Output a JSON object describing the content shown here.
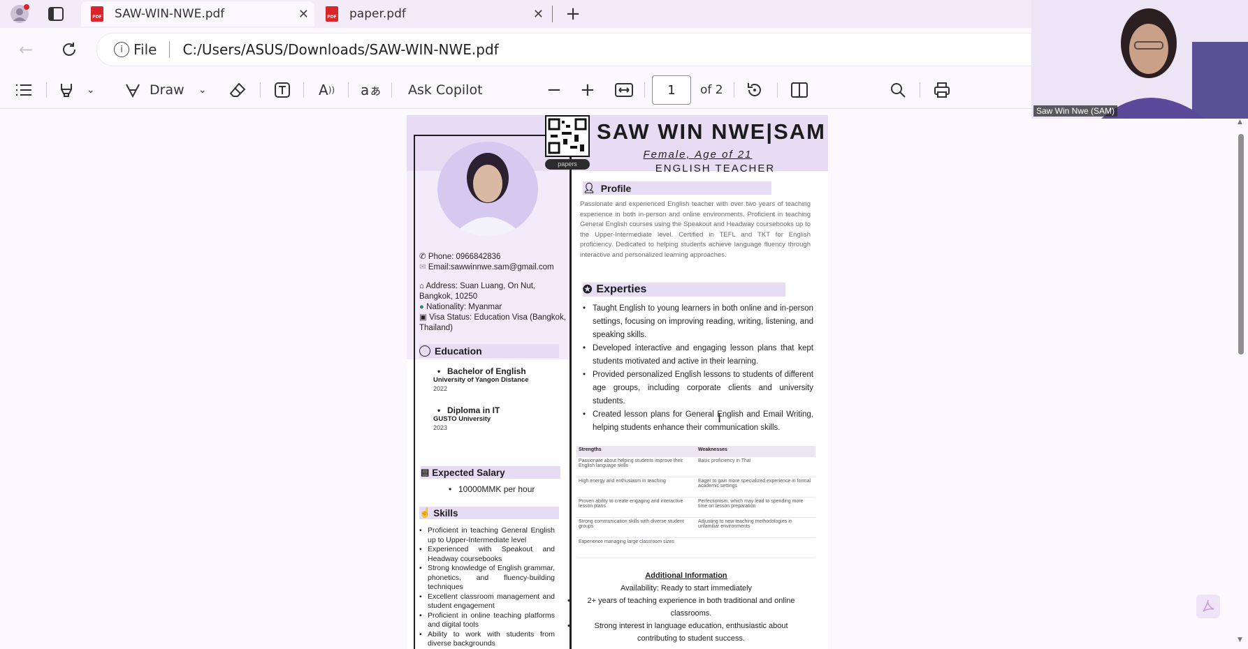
{
  "browser": {
    "tabs": [
      {
        "title": "SAW-WIN-NWE.pdf",
        "active": true
      },
      {
        "title": "paper.pdf",
        "active": false
      }
    ],
    "file_label": "File",
    "url": "C:/Users/ASUS/Downloads/SAW-WIN-NWE.pdf"
  },
  "toolbar": {
    "draw_label": "Draw",
    "copilot_label": "Ask Copilot",
    "page_current": "1",
    "page_total": "of 2"
  },
  "video": {
    "participant": "Saw Win Nwe (SAM)"
  },
  "resume": {
    "qr_caption": "papers",
    "name": "SAW WIN NWE|SAM",
    "subtitle": "Female, Age of 21",
    "role": "ENGLISH TEACHER",
    "contact": {
      "phone": "Phone: 0966842836",
      "email": "Email:sawwinnwe.sam@gmail.com",
      "address": "Address: Suan Luang, On Nut, Bangkok, 10250",
      "nationality": "Nationality: Myanmar",
      "visa": "Visa Status: Education Visa (Bangkok, Thailand)"
    },
    "education": {
      "heading": "Education",
      "items": [
        {
          "degree": "Bachelor of English",
          "school": "University of Yangon Distance",
          "year": "2022"
        },
        {
          "degree": "Diploma in IT",
          "school": "GUSTO University",
          "year": "2023"
        }
      ]
    },
    "salary": {
      "heading": "Expected Salary",
      "value": "10000MMK per hour"
    },
    "skills": {
      "heading": "Skills",
      "items": [
        "Proficient in teaching General English up to Upper-Intermediate level",
        "Experienced with Speakout and Headway coursebooks",
        "Strong knowledge of English grammar, phonetics, and fluency-building techniques",
        "Excellent classroom management and student engagement",
        "Proficient in online teaching platforms and digital tools",
        "Ability to work with students from diverse backgrounds"
      ]
    },
    "profile": {
      "heading": "Profile",
      "text": "Passionate and experienced English teacher with over two years of teaching experience in both in-person and online environments. Proficient in teaching General English courses using the Speakout and Headway coursebooks up to the Upper-Intermediate level. Certified in TEFL and TKT for English proficiency. Dedicated to helping students achieve language fluency through interactive and personalized learning approaches."
    },
    "experties": {
      "heading": "Experties",
      "items": [
        "Taught English to young learners in both online and in-person settings, focusing on improving reading, writing, listening, and speaking skills.",
        "Developed interactive and engaging lesson plans that kept students motivated and active in their learning.",
        "Provided personalized English lessons to students of different age groups, including corporate clients and university students.",
        "Created lesson plans for General English and Email Writing, helping students enhance their communication skills."
      ]
    },
    "sw_table": {
      "headers": [
        "Strengths",
        "Weaknesses"
      ],
      "rows": [
        [
          "Passionate about helping students improve their English language skills",
          "Basic proficiency in Thai"
        ],
        [
          "High energy and enthusiasm in teaching",
          "Eager to gain more specialized experience in formal academic settings"
        ],
        [
          "Proven ability to create engaging and interactive lesson plans",
          "Perfectionism, which may lead to spending more time on lesson preparation"
        ],
        [
          "Strong communication skills with diverse student groups",
          "Adjusting to new teaching methodologies in unfamiliar environments"
        ],
        [
          "Experience managing large classroom sizes",
          ""
        ]
      ]
    },
    "additional": {
      "heading": "Additional Information",
      "availability": "Availability: Ready to start immediately",
      "items": [
        "2+ years of teaching experience in both traditional and online classrooms.",
        "Strong interest in language education, enthusiastic about contributing to student success."
      ]
    }
  },
  "colors": {
    "accent": "#d9262b",
    "lavender": "#e8dcf5",
    "chrome": "#f1ecf8"
  }
}
